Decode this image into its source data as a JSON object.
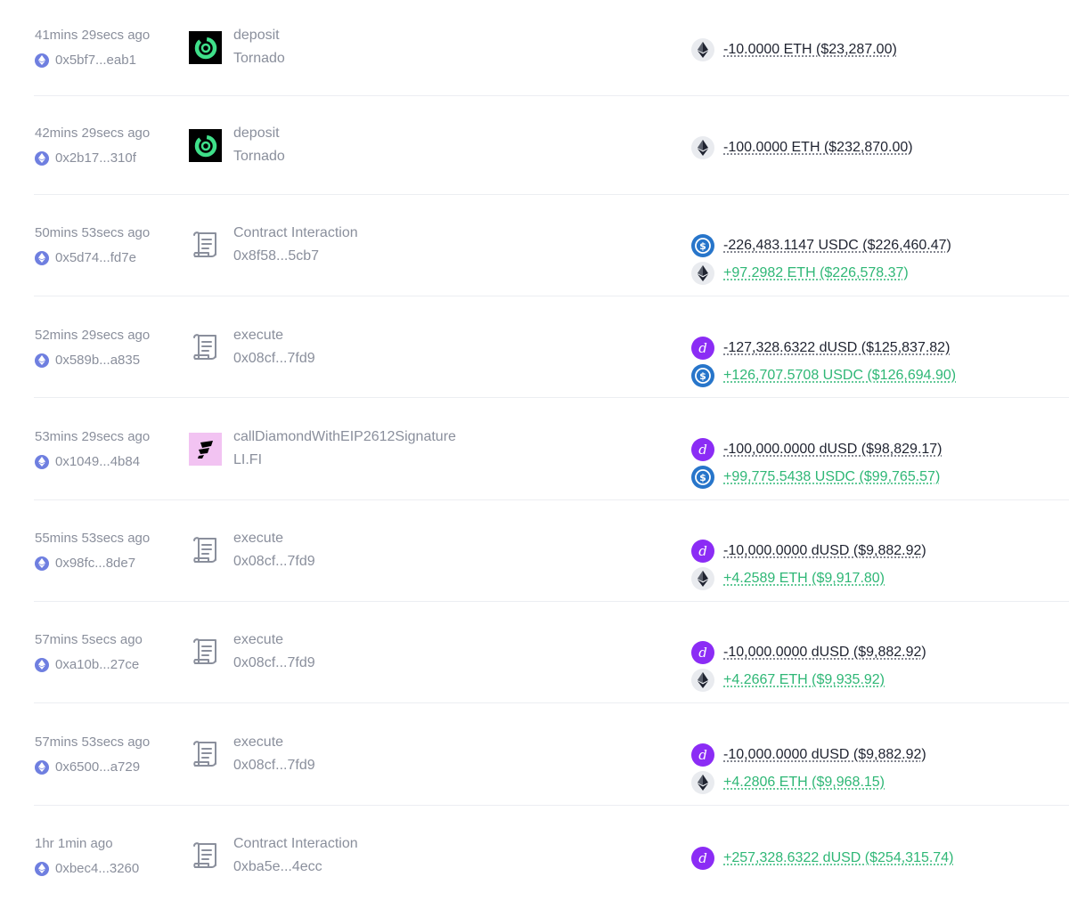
{
  "colors": {
    "positive": "#2fb776",
    "negative": "#1f2330",
    "muted": "#8a8f9c",
    "usdc": "#2775ca",
    "dusd": "#8b2cf5"
  },
  "rows": [
    {
      "time": "41mins 29secs ago",
      "hash": "0x5bf7...eab1",
      "app_icon": "tornado-logo",
      "method": "deposit",
      "target": "Tornado",
      "transfers": [
        {
          "token": "eth",
          "text": "-10.0000 ETH ($23,287.00)",
          "dir": "neg"
        }
      ]
    },
    {
      "time": "42mins 29secs ago",
      "hash": "0x2b17...310f",
      "app_icon": "tornado-logo",
      "method": "deposit",
      "target": "Tornado",
      "transfers": [
        {
          "token": "eth",
          "text": "-100.0000 ETH ($232,870.00)",
          "dir": "neg"
        }
      ]
    },
    {
      "time": "50mins 53secs ago",
      "hash": "0x5d74...fd7e",
      "app_icon": "contract-scroll-icon",
      "method": "Contract Interaction",
      "target": "0x8f58...5cb7",
      "transfers": [
        {
          "token": "usdc",
          "text": "-226,483.1147 USDC ($226,460.47)",
          "dir": "neg"
        },
        {
          "token": "eth",
          "text": "+97.2982 ETH ($226,578.37)",
          "dir": "pos"
        }
      ]
    },
    {
      "time": "52mins 29secs ago",
      "hash": "0x589b...a835",
      "app_icon": "contract-scroll-icon",
      "method": "execute",
      "target": "0x08cf...7fd9",
      "transfers": [
        {
          "token": "dusd",
          "text": "-127,328.6322 dUSD ($125,837.82)",
          "dir": "neg"
        },
        {
          "token": "usdc",
          "text": "+126,707.5708 USDC ($126,694.90)",
          "dir": "pos"
        }
      ]
    },
    {
      "time": "53mins 29secs ago",
      "hash": "0x1049...4b84",
      "app_icon": "lifi-logo",
      "method": "callDiamondWithEIP2612Signature",
      "target": "LI.FI",
      "transfers": [
        {
          "token": "dusd",
          "text": "-100,000.0000 dUSD ($98,829.17)",
          "dir": "neg"
        },
        {
          "token": "usdc",
          "text": "+99,775.5438 USDC ($99,765.57)",
          "dir": "pos"
        }
      ]
    },
    {
      "time": "55mins 53secs ago",
      "hash": "0x98fc...8de7",
      "app_icon": "contract-scroll-icon",
      "method": "execute",
      "target": "0x08cf...7fd9",
      "transfers": [
        {
          "token": "dusd",
          "text": "-10,000.0000 dUSD ($9,882.92)",
          "dir": "neg"
        },
        {
          "token": "eth",
          "text": "+4.2589 ETH ($9,917.80)",
          "dir": "pos"
        }
      ]
    },
    {
      "time": "57mins 5secs ago",
      "hash": "0xa10b...27ce",
      "app_icon": "contract-scroll-icon",
      "method": "execute",
      "target": "0x08cf...7fd9",
      "transfers": [
        {
          "token": "dusd",
          "text": "-10,000.0000 dUSD ($9,882.92)",
          "dir": "neg"
        },
        {
          "token": "eth",
          "text": "+4.2667 ETH ($9,935.92)",
          "dir": "pos"
        }
      ]
    },
    {
      "time": "57mins 53secs ago",
      "hash": "0x6500...a729",
      "app_icon": "contract-scroll-icon",
      "method": "execute",
      "target": "0x08cf...7fd9",
      "transfers": [
        {
          "token": "dusd",
          "text": "-10,000.0000 dUSD ($9,882.92)",
          "dir": "neg"
        },
        {
          "token": "eth",
          "text": "+4.2806 ETH ($9,968.15)",
          "dir": "pos"
        }
      ]
    },
    {
      "time": "1hr 1min ago",
      "hash": "0xbec4...3260",
      "app_icon": "contract-scroll-icon",
      "method": "Contract Interaction",
      "target": "0xba5e...4ecc",
      "transfers": [
        {
          "token": "dusd",
          "text": "+257,328.6322 dUSD ($254,315.74)",
          "dir": "pos"
        }
      ]
    }
  ]
}
